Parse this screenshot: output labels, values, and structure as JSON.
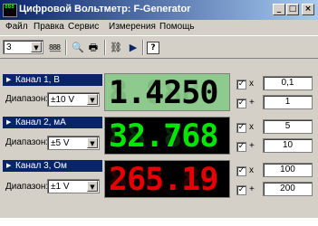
{
  "window": {
    "title": "Цифровой Вольтметр: F-Generator",
    "icon_text": "888"
  },
  "menu": [
    {
      "label": "Файл"
    },
    {
      "label": "Правка"
    },
    {
      "label": "Сервис"
    },
    {
      "label": "Измерения"
    },
    {
      "label": "Помощь"
    }
  ],
  "toolbar": {
    "channel_count": "3"
  },
  "channels": [
    {
      "label": "Канал 1, В",
      "range_label": "Диапазон:",
      "range": "±10 V",
      "display": "1.4250",
      "ghost": "8.8888",
      "multiplier_op": "x",
      "multiplier": "0,1",
      "offset_op": "+",
      "offset": "1",
      "multiplier_checked": true,
      "offset_checked": true
    },
    {
      "label": "Канал 2, мА",
      "range_label": "Диапазон:",
      "range": "±5 V",
      "display": "32.768",
      "ghost": "88.888",
      "multiplier_op": "x",
      "multiplier": "5",
      "offset_op": "+",
      "offset": "10",
      "multiplier_checked": true,
      "offset_checked": true
    },
    {
      "label": "Канал 3, Ом",
      "range_label": "Диапазон:",
      "range": "±1 V",
      "display": "265.19",
      "ghost": "888.88",
      "multiplier_op": "x",
      "multiplier": "100",
      "offset_op": "+",
      "offset": "200",
      "multiplier_checked": true,
      "offset_checked": true
    }
  ],
  "colors": {
    "lcd1_bg": "#8ec98e",
    "lcd2_digits": "#00e600",
    "lcd3_digits": "#e60000",
    "title_bar": "#0a246a"
  }
}
